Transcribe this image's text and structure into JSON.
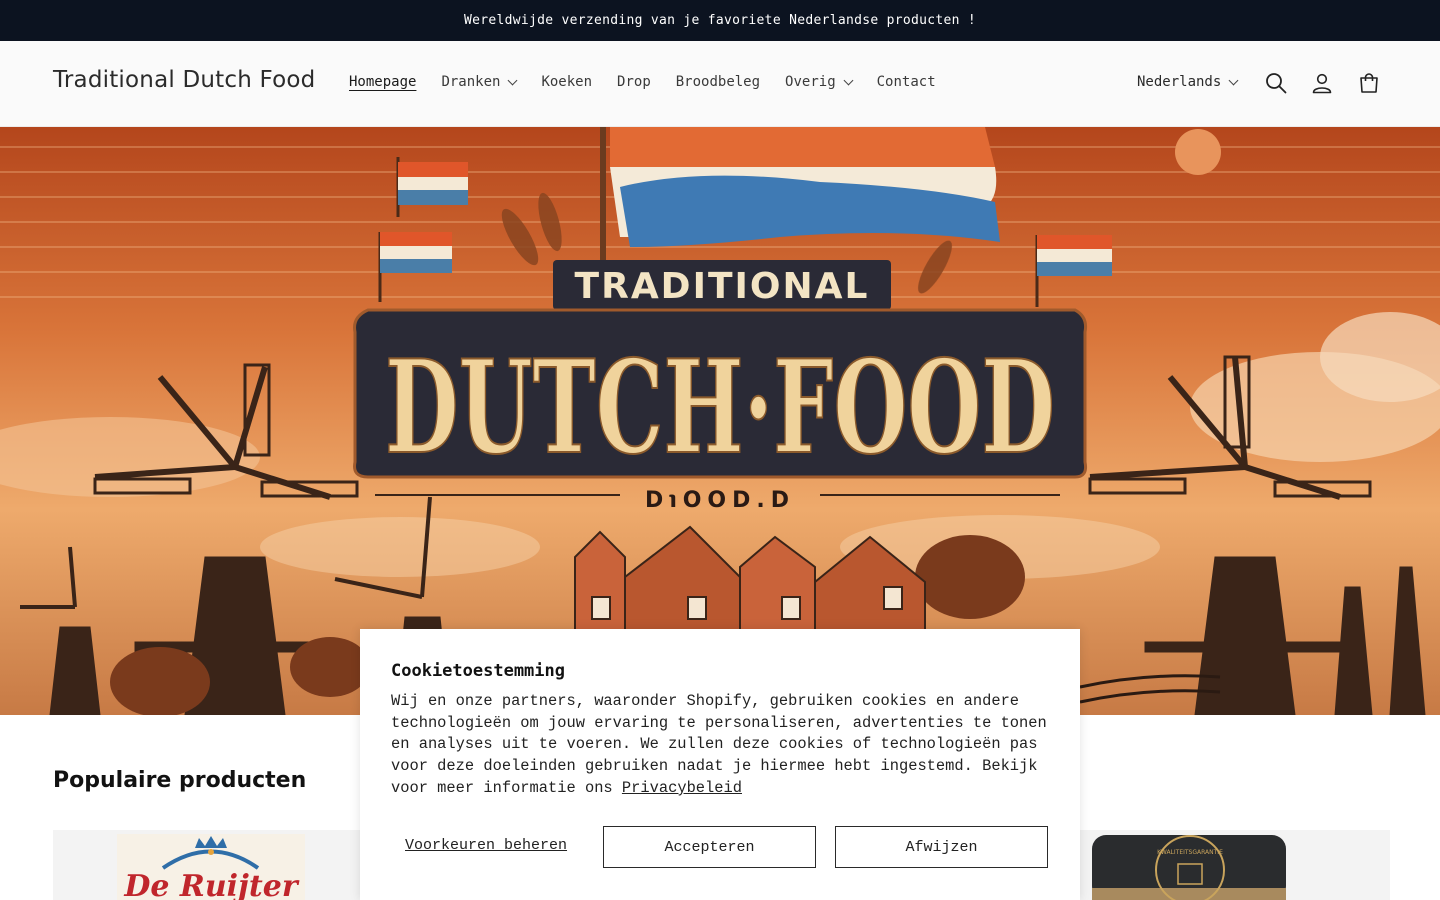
{
  "announcement": {
    "text": "Wereldwijde verzending van je favoriete Nederlandse producten !"
  },
  "header": {
    "logo": "Traditional Dutch Food",
    "nav": [
      {
        "label": "Homepage",
        "active": true,
        "dropdown": false
      },
      {
        "label": "Dranken",
        "active": false,
        "dropdown": true
      },
      {
        "label": "Koeken",
        "active": false,
        "dropdown": false
      },
      {
        "label": "Drop",
        "active": false,
        "dropdown": false
      },
      {
        "label": "Broodbeleg",
        "active": false,
        "dropdown": false
      },
      {
        "label": "Overig",
        "active": false,
        "dropdown": true
      },
      {
        "label": "Contact",
        "active": false,
        "dropdown": false
      }
    ],
    "language": "Nederlands",
    "icons": [
      "search-icon",
      "account-icon",
      "cart-icon"
    ]
  },
  "hero": {
    "banner_top": "TRADITIONAL",
    "banner_main": "DUTCH·FOOD",
    "banner_sub": "D℩OOD.D"
  },
  "popular": {
    "title": "Populaire producten"
  },
  "products": [
    {
      "brand_text": "De Ruijter"
    },
    {
      "label_text": "KWALITEITSGARANTIE"
    }
  ],
  "cookie": {
    "title": "Cookietoestemming",
    "body": "Wij en onze partners, waaronder Shopify, gebruiken cookies en andere technologieën om jouw ervaring te personaliseren, advertenties te tonen en analyses uit te voeren. We zullen deze cookies of technologieën pas voor deze doeleinden gebruiken nadat je hiermee hebt ingestemd. Bekijk voor meer informatie ons",
    "link": "Privacybeleid",
    "manage": "Voorkeuren beheren",
    "accept": "Accepteren",
    "decline": "Afwijzen"
  },
  "colors": {
    "announcement_bg": "#0c1320",
    "header_bg": "#fafafa",
    "flag_red": "#e0562a",
    "flag_blue": "#4a7ea8",
    "banner_dark": "#2a2a36",
    "banner_gold": "#f0d39c"
  }
}
